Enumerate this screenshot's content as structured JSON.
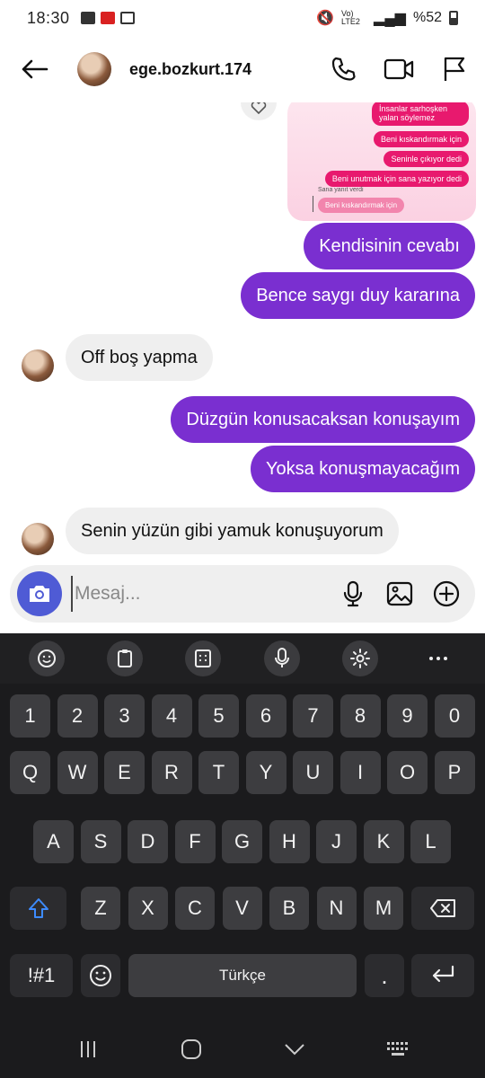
{
  "status_bar": {
    "time": "18:30",
    "battery": "%52",
    "network": "Vo) LTE2"
  },
  "header": {
    "username": "ege.bozkurt.174"
  },
  "story": {
    "bubbles": [
      "İnsanlar sarhoşken yalan söylemez",
      "Beni kıskandırmak için",
      "Seninle çıkıyor dedi",
      "Beni unutmak için sana yazıyor dedi"
    ],
    "reply_label": "Sana yanıt verdi",
    "reply_text": "Beni kıskandırmak için"
  },
  "messages": [
    {
      "dir": "out",
      "text": "Kendisinin cevabı"
    },
    {
      "dir": "out",
      "text": "Bence saygı duy kararına"
    },
    {
      "dir": "in",
      "text": "Off boş yapma"
    },
    {
      "dir": "out",
      "text": "Düzgün konusacaksan konuşayım"
    },
    {
      "dir": "out",
      "text": "Yoksa konuşmayacağım"
    },
    {
      "dir": "in",
      "text": "Senin yüzün gibi yamuk konuşuyorum"
    }
  ],
  "composer": {
    "placeholder": "Mesaj..."
  },
  "keyboard": {
    "row_numbers": [
      "1",
      "2",
      "3",
      "4",
      "5",
      "6",
      "7",
      "8",
      "9",
      "0"
    ],
    "row_q": [
      "Q",
      "W",
      "E",
      "R",
      "T",
      "Y",
      "U",
      "I",
      "O",
      "P"
    ],
    "row_a": [
      "A",
      "S",
      "D",
      "F",
      "G",
      "H",
      "J",
      "K",
      "L"
    ],
    "row_z": [
      "Z",
      "X",
      "C",
      "V",
      "B",
      "N",
      "M"
    ],
    "symbols_label": "!#1",
    "space_label": "Türkçe",
    "period_label": "."
  },
  "colors": {
    "outgoing": "#7a2fd0",
    "incoming": "#efefef",
    "camera": "#4f5bd5",
    "story_pink": "#e8196e"
  }
}
